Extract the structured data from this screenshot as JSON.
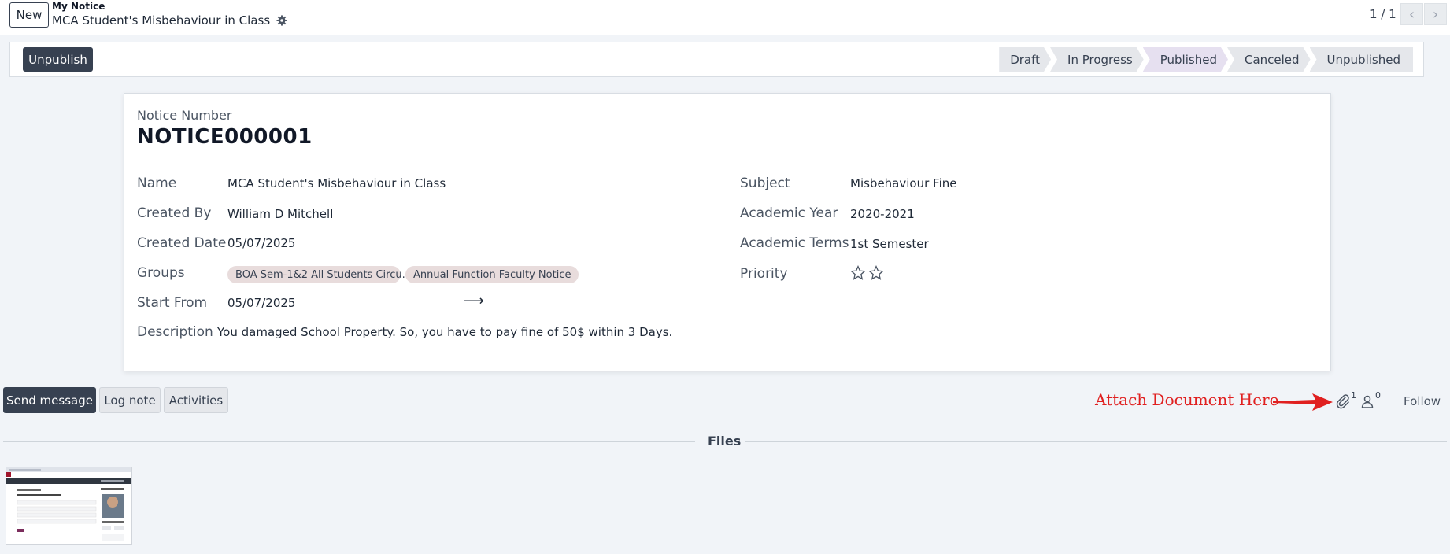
{
  "breadcrumb": {
    "new_label": "New",
    "parent": "My Notice",
    "current": "MCA Student's Misbehaviour in Class",
    "settings_icon": "gear-icon"
  },
  "pager": {
    "value": "1 / 1",
    "prev_icon": "chevron-left-icon",
    "next_icon": "chevron-right-icon"
  },
  "header": {
    "unpublish_label": "Unpublish",
    "stages": [
      "Draft",
      "In Progress",
      "Published",
      "Canceled",
      "Unpublished"
    ],
    "active_stage": "Published"
  },
  "form": {
    "notice_number_label": "Notice Number",
    "notice_number": "NOTICE000001",
    "left_fields": {
      "name_label": "Name",
      "name": "MCA Student's Misbehaviour in Class",
      "created_by_label": "Created By",
      "created_by": "William D Mitchell",
      "created_date_label": "Created Date",
      "created_date": "05/07/2025",
      "groups_label": "Groups",
      "groups": [
        "BOA Sem-1&2 All Students Circu...",
        "Annual Function Faculty Notice"
      ],
      "start_from_label": "Start From",
      "start_from": "05/07/2025",
      "range_arrow": "⟶",
      "description_label": "Description",
      "description": "You damaged School Property. So, you have to pay fine of 50$ within 3 Days."
    },
    "right_fields": {
      "subject_label": "Subject",
      "subject": "Misbehaviour Fine",
      "academic_year_label": "Academic Year",
      "academic_year": "2020-2021",
      "academic_terms_label": "Academic Terms",
      "academic_terms": "1st Semester",
      "priority_label": "Priority",
      "priority_stars_filled": 0,
      "priority_stars_total": 2
    }
  },
  "chatter": {
    "send_message_label": "Send message",
    "log_note_label": "Log note",
    "activities_label": "Activities",
    "annotation": "Attach Document Here",
    "attachment_count": "1",
    "follower_count": "0",
    "follow_label": "Follow",
    "files_label": "Files"
  },
  "colors": {
    "primary_button": "#374151",
    "active_stage": "#e6e0f0",
    "tag": "#e8dcdc",
    "annotation": "#e02020"
  }
}
